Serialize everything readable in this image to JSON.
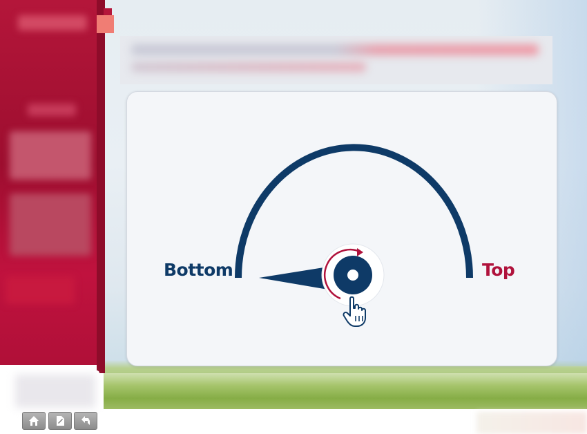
{
  "gauge": {
    "left_label": "Bottom",
    "right_label": "Top",
    "level_fraction": 0.0
  },
  "icons": {
    "rotate": "rotate-arrow-icon",
    "hand": "hand-pointer-icon",
    "home": "home-icon",
    "notes": "notes-icon",
    "back": "back-arrow-icon"
  },
  "colors": {
    "sidebar": "#b4163a",
    "navy": "#0e3a67",
    "crimson": "#b0123c",
    "card": "#f4f6f9"
  }
}
